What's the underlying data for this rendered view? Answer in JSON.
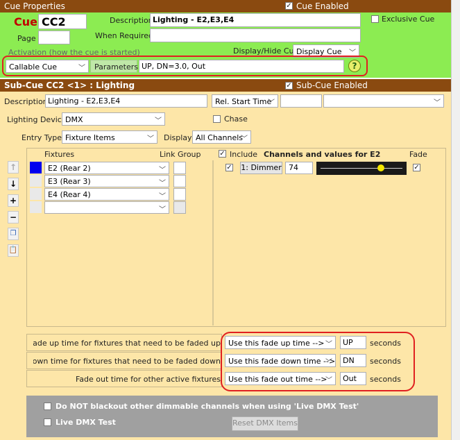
{
  "cue_properties": {
    "title": "Cue Properties",
    "cue_enabled_label": "Cue Enabled",
    "cue_enabled": true,
    "cue_label": "Cue",
    "cue_value": "CC2",
    "page_label": "Page",
    "page_value": "",
    "description_label": "Description",
    "description_value": "Lighting - E2,E3,E4",
    "exclusive_label": "Exclusive Cue",
    "exclusive": false,
    "when_required_label": "When Required",
    "when_required_value": "",
    "activation_label": "Activation (how the cue is started)",
    "display_hide_label": "Display/Hide Cue",
    "display_hide_value": "Display Cue",
    "activation_value": "Callable Cue",
    "parameters_label": "Parameters",
    "parameters_value": "UP, DN=3.0, Out",
    "help_icon": "question-circle-icon"
  },
  "subcue": {
    "title": "Sub-Cue CC2 <1> : Lighting",
    "enabled_label": "Sub-Cue Enabled",
    "enabled": true,
    "description_label": "Description",
    "description_value": "Lighting - E2,E3,E4",
    "rel_start_value": "Rel. Start Time",
    "rel_start_time": "",
    "rel_start_extra": "",
    "lighting_device_label": "Lighting Device",
    "lighting_device_value": "DMX",
    "chase_label": "Chase",
    "chase": false,
    "entry_type_label": "Entry Type",
    "entry_type_value": "Fixture Items",
    "display_label": "Display",
    "display_value": "All Channels",
    "fixtures_header": "Fixtures",
    "link_group_header": "Link Group",
    "include_label": "Include",
    "channels_header": "Channels and values for E2",
    "fade_header": "Fade",
    "fixtures": [
      {
        "name": "E2 (Rear 2)",
        "color": "#0000ee"
      },
      {
        "name": "E3 (Rear 3)",
        "color": ""
      },
      {
        "name": "E4 (Rear 4)",
        "color": ""
      },
      {
        "name": "",
        "color": ""
      }
    ],
    "channels": [
      {
        "label": "1: Dimmer",
        "value": "74",
        "level": 0.74,
        "fade": true,
        "include": true
      }
    ],
    "toolbar_icons": [
      "arrow-up-icon",
      "arrow-down-icon",
      "plus-icon",
      "minus-icon",
      "copy-icon",
      "paste-icon"
    ]
  },
  "fade_times": [
    {
      "label": "Fade up time for fixtures that need to be faded up",
      "option": "Use this fade up time -->",
      "value": "UP",
      "unit": "seconds"
    },
    {
      "label": "Fade down time for fixtures that need to be faded down",
      "option": "Use this fade down time -->",
      "value": "DN",
      "unit": "seconds"
    },
    {
      "label": "Fade out time for other active fixtures",
      "option": "Use this fade out time -->",
      "value": "Out",
      "unit": "seconds"
    }
  ],
  "dmx": {
    "no_blackout_label": "Do NOT blackout other dimmable channels when using 'Live DMX Test'",
    "no_blackout": false,
    "live_test_label": "Live DMX Test",
    "live_test": false,
    "reset_label": "Reset DMX Items"
  },
  "colors": {
    "header_brown": "#8a4a10",
    "green_panel": "#8cec52",
    "tan_panel": "#fde6a8",
    "dmx_panel": "#a0a0a0",
    "highlight_red": "#e02020"
  }
}
